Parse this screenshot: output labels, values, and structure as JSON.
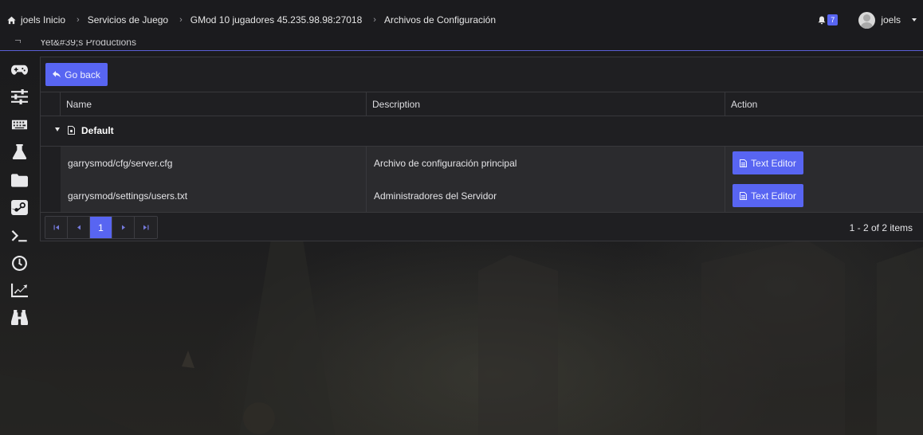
{
  "breadcrumb": {
    "home": "joels Inicio",
    "items": [
      "Servicios de Juego",
      "GMod 10 jugadores 45.235.98.98:27018",
      "Archivos de Configuración"
    ]
  },
  "header": {
    "notifications_count": "7",
    "username": "joels"
  },
  "subbar": {
    "org": "Yet&#39;s Productions"
  },
  "sidebar": {
    "icons": [
      "gamepad-icon",
      "sliders-icon",
      "keyboard-icon",
      "flask-icon",
      "folder-icon",
      "steam-icon",
      "terminal-icon",
      "clock-icon",
      "chart-line-icon",
      "binoculars-icon"
    ]
  },
  "toolbar": {
    "back_label": "Go back"
  },
  "grid": {
    "columns": [
      "Name",
      "Description",
      "Action"
    ],
    "group": "Default",
    "rows": [
      {
        "name": "garrysmod/cfg/server.cfg",
        "description": "Archivo de configuración principal",
        "action": "Text Editor"
      },
      {
        "name": "garrysmod/settings/users.txt",
        "description": "Administradores del Servidor",
        "action": "Text Editor"
      }
    ]
  },
  "pager": {
    "current_page": "1",
    "info": "1 - 2 of 2 items"
  },
  "colors": {
    "accent": "#5865f2",
    "background": "#1f1f22"
  }
}
